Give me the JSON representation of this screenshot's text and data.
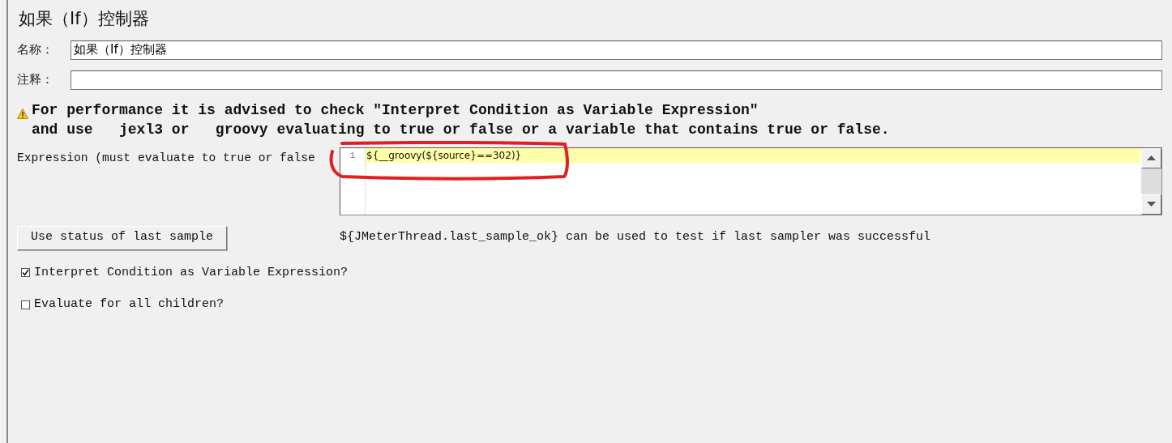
{
  "title": "如果（If）控制器",
  "fields": [
    {
      "label": "名称：",
      "value": "如果（If）控制器"
    },
    {
      "label": "注释："
    }
  ],
  "warning": {
    "lines": [
      "For performance it is advised to check \"Interpret Condition as Variable Expression\"",
      "and use   jexl3 or   groovy evaluating to true or false or a variable that contains true or false."
    ]
  },
  "expression": {
    "label": "Expression (must evaluate to true or false",
    "lines": [
      {
        "number": "1",
        "code": "${__groovy(${source}==302)}",
        "highlighted": true
      }
    ]
  },
  "button": {
    "label": "Use status of last sample"
  },
  "hint": "${JMeterThread.last_sample_ok} can be used to test if last sampler was successful",
  "checkboxes": [
    {
      "label": "Interpret Condition as Variable Expression?",
      "checked": true
    },
    {
      "label": "Evaluate for all children?",
      "checked": false
    }
  ]
}
